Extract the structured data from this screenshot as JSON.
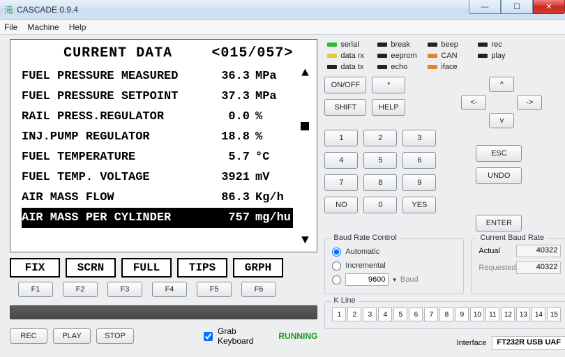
{
  "window": {
    "title": "CASCADE 0.9.4",
    "icon": "滝"
  },
  "menu": {
    "file": "File",
    "machine": "Machine",
    "help": "Help"
  },
  "lcd": {
    "title": "CURRENT DATA",
    "page": "<015/057>",
    "rows": [
      {
        "label": "FUEL PRESSURE MEASURED",
        "value": "36.3",
        "unit": "MPa"
      },
      {
        "label": "FUEL PRESSURE SETPOINT",
        "value": "37.3",
        "unit": "MPa"
      },
      {
        "label": "RAIL PRESS.REGULATOR",
        "value": "0.0",
        "unit": "%"
      },
      {
        "label": "INJ.PUMP REGULATOR",
        "value": "18.8",
        "unit": "%"
      },
      {
        "label": "FUEL TEMPERATURE",
        "value": "5.7",
        "unit": "°C"
      },
      {
        "label": "FUEL TEMP. VOLTAGE",
        "value": "3921",
        "unit": "mV"
      },
      {
        "label": "AIR MASS FLOW",
        "value": "86.3",
        "unit": "Kg/h"
      },
      {
        "label": "AIR MASS PER CYLINDER",
        "value": "757",
        "unit": "mg/hu",
        "selected": true
      }
    ],
    "softkeys": [
      "FIX",
      "SCRN",
      "FULL",
      "TIPS",
      "GRPH"
    ],
    "fnkeys": [
      "F1",
      "F2",
      "F3",
      "F4",
      "F5",
      "F6"
    ]
  },
  "controls": {
    "rec": "REC",
    "play": "PLAY",
    "stop": "STOP",
    "grab_keyboard": "Grab Keyboard",
    "running": "RUNNING"
  },
  "leds": [
    {
      "name": "serial",
      "color": "g"
    },
    {
      "name": "break",
      "color": "k"
    },
    {
      "name": "beep",
      "color": "k"
    },
    {
      "name": "rec",
      "color": "k"
    },
    {
      "name": "data rx",
      "color": "y"
    },
    {
      "name": "eeprom",
      "color": "k"
    },
    {
      "name": "CAN",
      "color": "o"
    },
    {
      "name": "play",
      "color": "k"
    },
    {
      "name": "data tx",
      "color": "k"
    },
    {
      "name": "echo",
      "color": "k"
    },
    {
      "name": "iface",
      "color": "o"
    }
  ],
  "keypad": {
    "onoff": "ON/OFF",
    "star": "*",
    "shift": "SHIFT",
    "help": "HELP",
    "digits": [
      "1",
      "2",
      "3",
      "4",
      "5",
      "6",
      "7",
      "8",
      "9",
      "0"
    ],
    "no": "NO",
    "yes": "YES",
    "left": "<-",
    "up": "^",
    "right": "->",
    "down": "v",
    "esc": "ESC",
    "undo": "UNDO",
    "enter": "ENTER"
  },
  "baud_control": {
    "legend": "Baud Rate Control",
    "automatic": "Automatic",
    "incremental": "Incremental",
    "manual_value": "9600",
    "unit": "Baud"
  },
  "current_baud": {
    "legend": "Current Baud Rate",
    "actual_label": "Actual",
    "actual_value": "40322",
    "requested_label": "Requested",
    "requested_value": "40322"
  },
  "kline": {
    "legend": "K Line",
    "cells": [
      "1",
      "2",
      "3",
      "4",
      "5",
      "6",
      "7",
      "8",
      "9",
      "10",
      "11",
      "12",
      "13",
      "14",
      "15"
    ]
  },
  "interface": {
    "label": "Interface",
    "value": "FT232R USB UAF"
  }
}
